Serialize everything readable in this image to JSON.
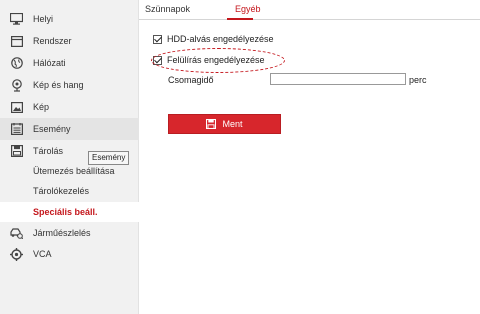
{
  "sidebar": {
    "items": [
      {
        "label": "Helyi",
        "icon": "monitor-icon"
      },
      {
        "label": "Rendszer",
        "icon": "system-icon"
      },
      {
        "label": "Hálózati",
        "icon": "globe-icon"
      },
      {
        "label": "Kép és hang",
        "icon": "audio-video-icon"
      },
      {
        "label": "Kép",
        "icon": "image-icon"
      },
      {
        "label": "Esemény",
        "icon": "event-list-icon"
      },
      {
        "label": "Tárolás",
        "icon": "storage-icon"
      },
      {
        "label": "Járműészlelés",
        "icon": "vehicle-detection-icon"
      },
      {
        "label": "VCA",
        "icon": "vca-icon"
      }
    ],
    "storage_sub": [
      {
        "label": "Ütemezés beállítása"
      },
      {
        "label": "Tárolókezelés"
      },
      {
        "label": "Speciális beáll."
      }
    ],
    "tooltip": "Esemény"
  },
  "tabs": [
    {
      "label": "Szünnapok"
    },
    {
      "label": "Egyéb"
    }
  ],
  "settings": {
    "hdd_sleep": {
      "label": "HDD-alvás engedélyezése",
      "checked": true
    },
    "overwrite": {
      "label": "Felülírás engedélyezése",
      "checked": true
    },
    "package_time": {
      "label": "Csomagidő",
      "value": "",
      "unit": "perc"
    }
  },
  "save_button": {
    "label": "Ment",
    "icon": "save-icon"
  },
  "colors": {
    "accent": "#c4161c",
    "button": "#d7262c",
    "sidebar_bg": "#f1f1f1",
    "highlight_bg": "#e4e4e4"
  }
}
